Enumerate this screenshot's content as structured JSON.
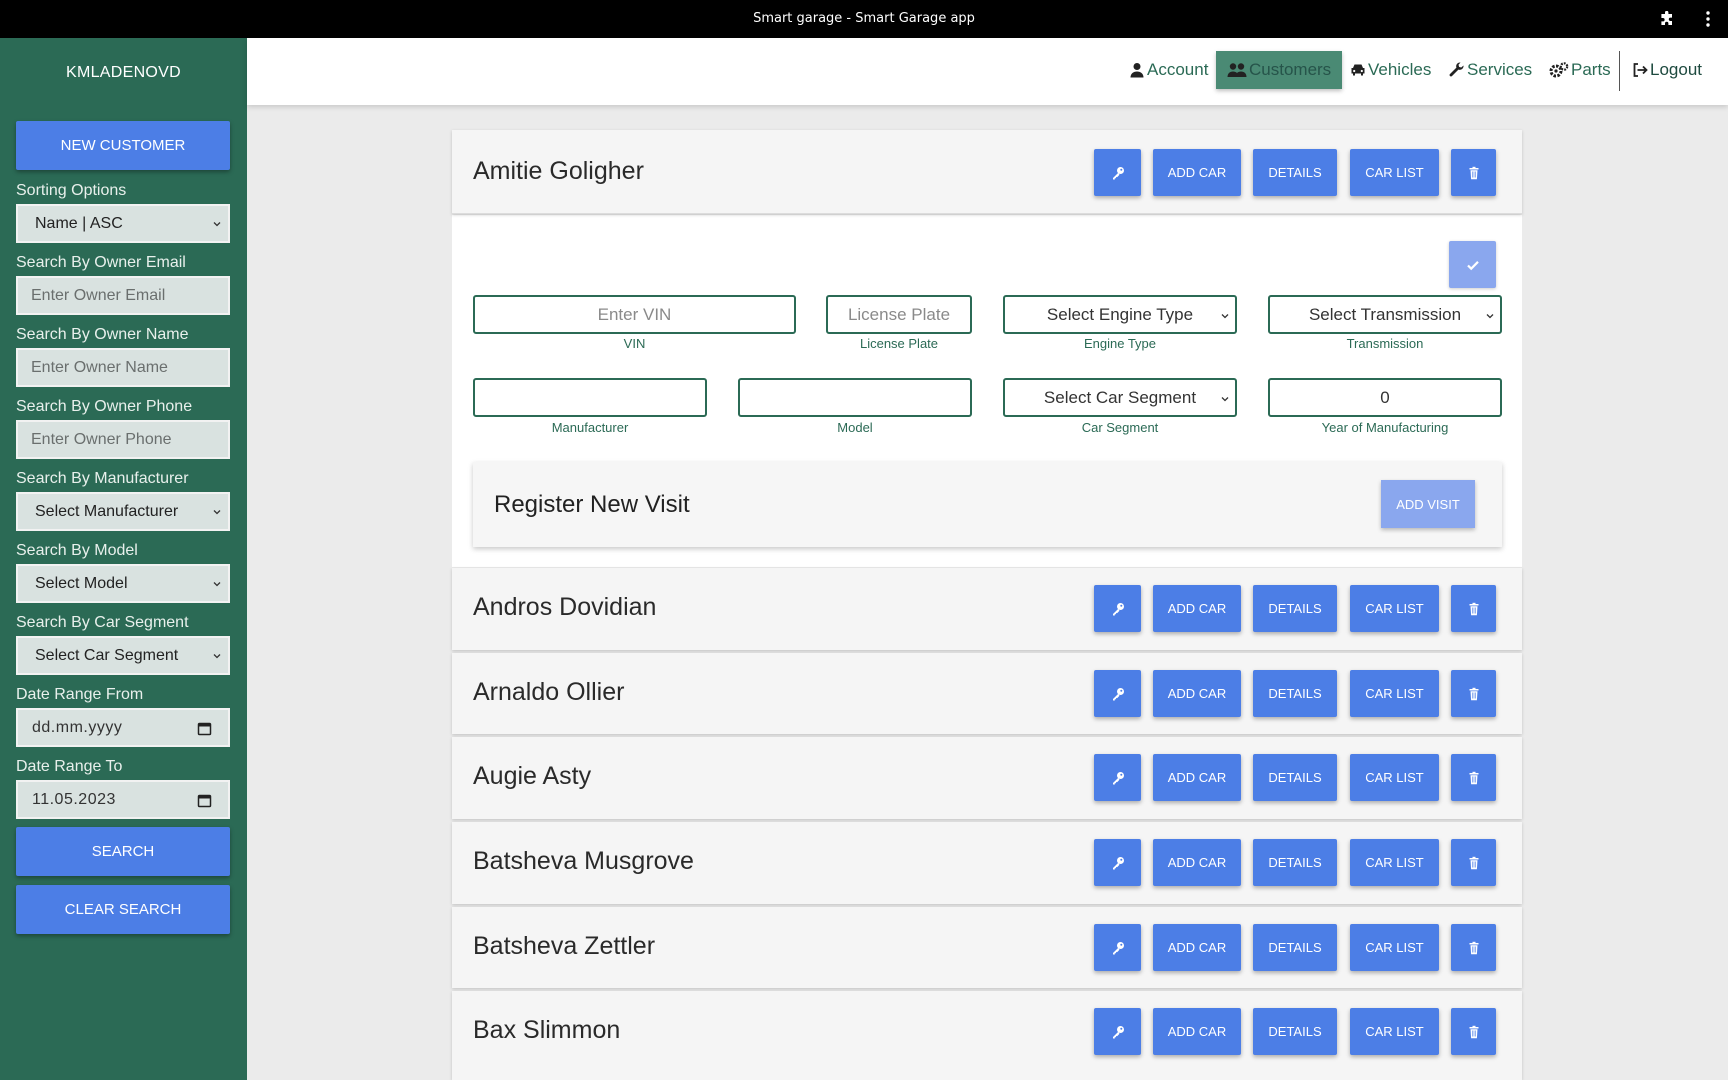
{
  "window": {
    "title": "Smart garage - Smart Garage app"
  },
  "sidebar": {
    "username": "KMLADENOVD",
    "new_customer": "NEW CUSTOMER",
    "sorting_label": "Sorting Options",
    "sorting_value": "Name | ASC",
    "email_label": "Search By Owner Email",
    "email_placeholder": "Enter Owner Email",
    "name_label": "Search By Owner Name",
    "name_placeholder": "Enter Owner Name",
    "phone_label": "Search By Owner Phone",
    "phone_placeholder": "Enter Owner Phone",
    "manufacturer_label": "Search By Manufacturer",
    "manufacturer_value": "Select Manufacturer",
    "model_label": "Search By Model",
    "model_value": "Select Model",
    "segment_label": "Search By Car Segment",
    "segment_value": "Select Car Segment",
    "date_from_label": "Date Range From",
    "date_from_value": "dd.mm.yyyy",
    "date_to_label": "Date Range To",
    "date_to_value": "11.05.2023",
    "search": "SEARCH",
    "clear_search": "CLEAR SEARCH"
  },
  "nav": {
    "account": "Account",
    "customers": "Customers",
    "vehicles": "Vehicles",
    "services": "Services",
    "parts": "Parts",
    "logout": "Logout"
  },
  "actions": {
    "add_car": "ADD CAR",
    "details": "DETAILS",
    "car_list": "CAR LIST"
  },
  "customers": [
    "Amitie Goligher",
    "Andros Dovidian",
    "Arnaldo Ollier",
    "Augie Asty",
    "Batsheva Musgrove",
    "Batsheva Zettler",
    "Bax Slimmon"
  ],
  "car_form": {
    "vin_placeholder": "Enter VIN",
    "vin_label": "VIN",
    "plate_placeholder": "License Plate",
    "plate_label": "License Plate",
    "engine_value": "Select Engine Type",
    "engine_label": "Engine Type",
    "transmission_value": "Select Transmission",
    "transmission_label": "Transmission",
    "manufacturer_value": "",
    "manufacturer_label": "Manufacturer",
    "model_value": "",
    "model_label": "Model",
    "segment_value": "Select Car Segment",
    "segment_label": "Car Segment",
    "year_value": "0",
    "year_label": "Year of Manufacturing"
  },
  "visit": {
    "title": "Register New Visit",
    "add_visit": "ADD VISIT"
  },
  "colors": {
    "sidebar": "#2b6a55",
    "button": "#4c7ee6",
    "button_disabled": "#8aa7ee"
  }
}
